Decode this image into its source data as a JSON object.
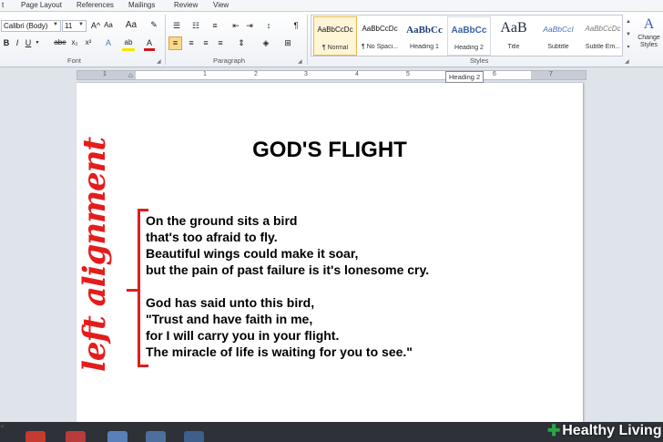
{
  "ribbon": {
    "tabs": [
      "t",
      "Page Layout",
      "References",
      "Mailings",
      "Review",
      "View"
    ],
    "font_name": "Calibri (Body)",
    "font_size": "11",
    "groups": {
      "font": "Font",
      "paragraph": "Paragraph",
      "styles": "Styles"
    },
    "font_buttons": [
      "B",
      "I",
      "U",
      "abe",
      "x₂",
      "x²",
      "A",
      "ab",
      "A"
    ],
    "grow_shrink": [
      "A^",
      "Aa"
    ],
    "styles": [
      {
        "sample": "AaBbCcDc",
        "name": "¶ Normal",
        "state": "selected"
      },
      {
        "sample": "AaBbCcDc",
        "name": "¶ No Spaci...",
        "state": ""
      },
      {
        "sample": "AaBbCc",
        "name": "Heading 1",
        "state": ""
      },
      {
        "sample": "AaBbCc",
        "name": "Heading 2",
        "state": "hover"
      },
      {
        "sample": "AaB",
        "name": "Title",
        "state": ""
      },
      {
        "sample": "AaBbCcI",
        "name": "Subtitle",
        "state": ""
      },
      {
        "sample": "AaBbCcDc",
        "name": "Subtle Em...",
        "state": ""
      }
    ],
    "change_styles": "Change Styles",
    "change_styles_icon": "A"
  },
  "ruler": {
    "tooltip": "Heading 2",
    "numbers": [
      "1",
      "1",
      "2",
      "3",
      "4",
      "5",
      "6",
      "7"
    ]
  },
  "document": {
    "title": "GOD'S FLIGHT",
    "stanza1": [
      "On the ground sits a bird",
      "that's too afraid to fly.",
      "Beautiful wings could make it soar,",
      "but the pain of past failure is it's lonesome cry."
    ],
    "stanza2": [
      "God has said unto this bird,",
      "\"Trust and have faith in me,",
      "for I will carry you in your flight.",
      "The miracle of life is waiting for you to see.\""
    ]
  },
  "annotation": {
    "text": "left alignment",
    "color": "#e51c1c"
  },
  "watermark": {
    "brand": "Healthy Living",
    "color": "#2aa64a"
  }
}
